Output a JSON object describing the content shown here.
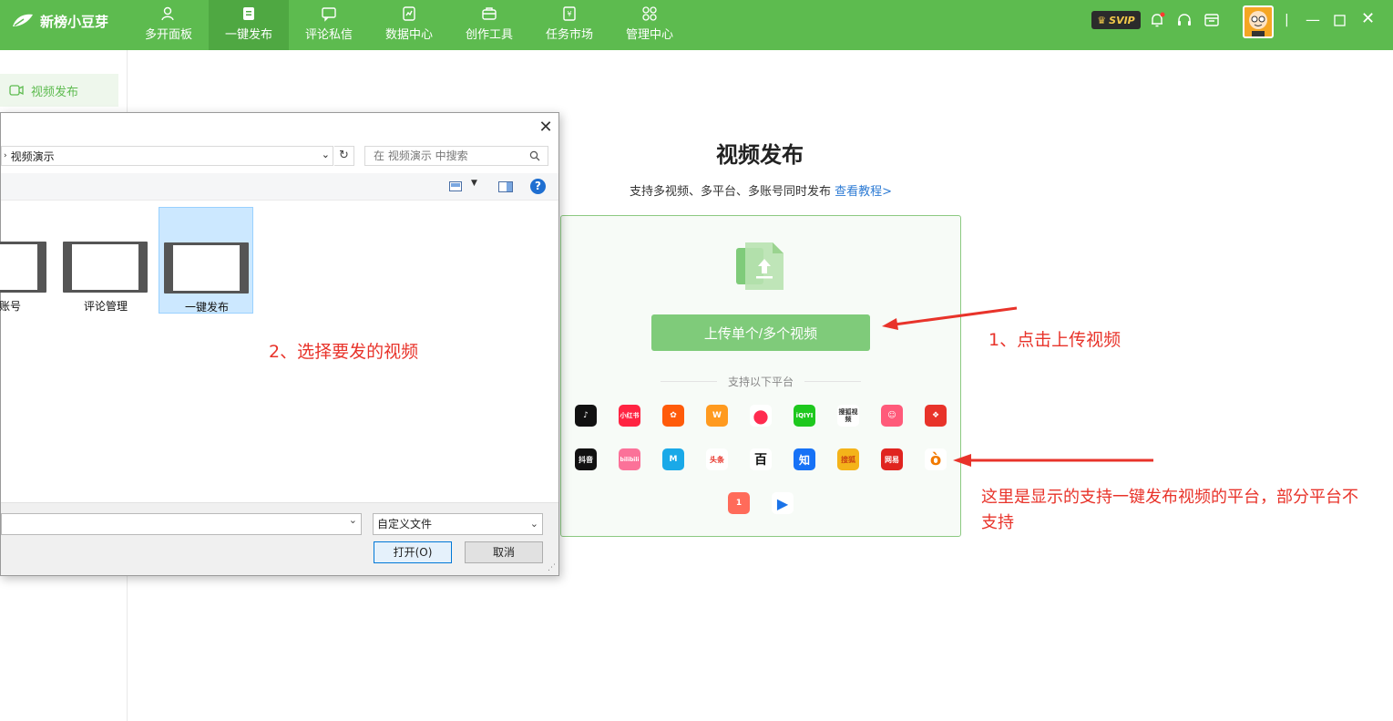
{
  "app": {
    "name": "新榜小豆芽",
    "nav": [
      {
        "label": "多开面板",
        "icon": "user-icon"
      },
      {
        "label": "一键发布",
        "icon": "publish-icon"
      },
      {
        "label": "评论私信",
        "icon": "message-icon"
      },
      {
        "label": "数据中心",
        "icon": "data-icon"
      },
      {
        "label": "创作工具",
        "icon": "toolbox-icon"
      },
      {
        "label": "任务市场",
        "icon": "market-icon"
      },
      {
        "label": "管理中心",
        "icon": "manage-icon"
      }
    ],
    "active_nav": "一键发布",
    "svip_label": "SVIP"
  },
  "sidebar": {
    "items": [
      {
        "label": "视频发布",
        "icon": "video-icon"
      }
    ]
  },
  "main": {
    "title": "视频发布",
    "subtitle": "支持多视频、多平台、多账号同时发布",
    "tutorial_link": "查看教程>",
    "upload_button": "上传单个/多个视频",
    "supported_label": "支持以下平台",
    "platform_icons": [
      "douyin-icon",
      "xiaohongshu-icon",
      "kuaishou-icon",
      "weishi-icon",
      "bilibili-like-icon",
      "iqiyi-icon",
      "sohu-video-icon",
      "haokan-icon",
      "cloud-icon",
      "douyin-video-icon",
      "bilibili-icon",
      "tiktok-light-icon",
      "toutiao-icon",
      "baidu-icon",
      "zhihu-icon",
      "sohu-icon",
      "netease-icon",
      "weibo-icon",
      "yidian-icon",
      "tencent-video-icon"
    ],
    "platform_labels": {
      "xiaohongshu": "小红书",
      "iqiyi": "iQIYI",
      "sohu_video": "搜狐视频",
      "douyin_video": "抖音",
      "bilibili": "bilibili",
      "toutiao": "头条",
      "zhihu": "知",
      "sohu": "搜狐",
      "netease": "网易"
    }
  },
  "dialog": {
    "path": "视频演示",
    "search_placeholder": "在 视频演示 中搜索",
    "files": [
      {
        "name": "体账号"
      },
      {
        "name": "评论管理"
      },
      {
        "name": "一键发布"
      }
    ],
    "selected_file": "一键发布",
    "file_type": "自定义文件",
    "open_button": "打开(O)",
    "cancel_button": "取消"
  },
  "annotations": {
    "step1": "1、点击上传视频",
    "step2": "2、选择要发的视频",
    "note": "这里是显示的支持一键发布视频的平台，部分平台不支持"
  },
  "colors": {
    "brand_green": "#5dbb4f",
    "button_green": "#7fcb7a",
    "annotation_red": "#e8332a",
    "link_blue": "#2d7bd4"
  }
}
